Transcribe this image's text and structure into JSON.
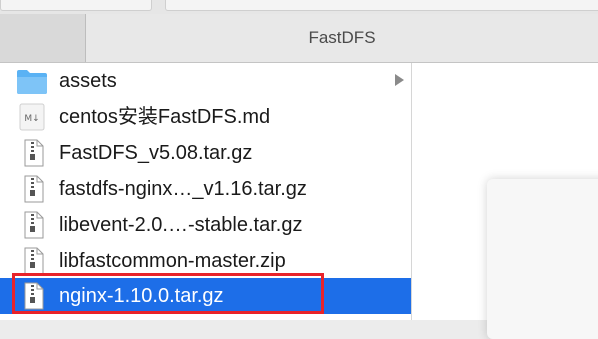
{
  "window": {
    "title": "FastDFS"
  },
  "files": [
    {
      "name": "assets",
      "icon": "folder-icon",
      "has_children": true
    },
    {
      "name": "centos安装FastDFS.md",
      "icon": "markdown-file-icon",
      "has_children": false
    },
    {
      "name": "FastDFS_v5.08.tar.gz",
      "icon": "archive-file-icon",
      "has_children": false
    },
    {
      "name": "fastdfs-nginx…_v1.16.tar.gz",
      "icon": "archive-file-icon",
      "has_children": false
    },
    {
      "name": "libevent-2.0.…-stable.tar.gz",
      "icon": "archive-file-icon",
      "has_children": false
    },
    {
      "name": "libfastcommon-master.zip",
      "icon": "archive-file-icon",
      "has_children": false
    },
    {
      "name": "nginx-1.10.0.tar.gz",
      "icon": "archive-file-icon",
      "has_children": false,
      "selected": true
    }
  ],
  "markdown_badge": "M↓",
  "colors": {
    "selection": "#1d6ee8",
    "annotation_box": "#e8232a",
    "folder": "#5ab2f4"
  }
}
